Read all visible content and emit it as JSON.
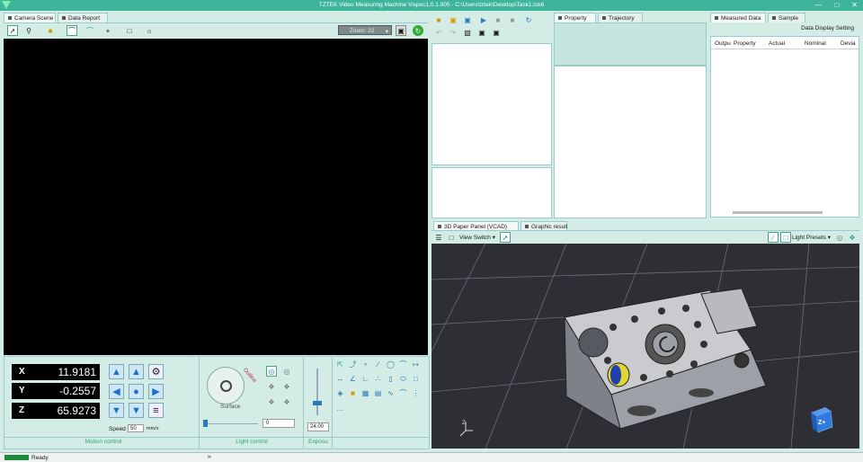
{
  "window": {
    "title": "TZTEK Video Measuring Machine Vispec1.0.1.005 - C:\\Users\\tztek\\Desktop\\Task1.tsk6"
  },
  "camera_panel": {
    "tabs": [
      "Camera Scene",
      "Data Report"
    ],
    "zoom_label": "Zoom: 22"
  },
  "dro": {
    "x_label": "X",
    "x_value": "11.9181",
    "y_label": "Y",
    "y_value": "-0.2557",
    "z_label": "Z",
    "z_value": "65.9273",
    "speed_label": "Speed",
    "speed_value": "50",
    "speed_unit": "mm/s"
  },
  "sections": {
    "motion": "Motion control",
    "light": "Light control",
    "exposure": "Exposu"
  },
  "light": {
    "outline_label": "Outline",
    "surface_label": "Surface",
    "slider_value": "0",
    "exposure_value": "24.00"
  },
  "property_panel": {
    "tabs": [
      "Property",
      "Trajectory"
    ]
  },
  "measured_panel": {
    "tabs": [
      "Measured Data",
      "Sample"
    ],
    "display_setting": "Data Display Setting",
    "columns": [
      "Outpu",
      "Property",
      "Actual",
      "Nominal",
      "Devia"
    ]
  },
  "cad_panel": {
    "tabs": [
      "3D Paper Panel (VCAD)",
      "Graphic result"
    ],
    "view_switch": "View Switch",
    "light_presets": "Light Presets",
    "cube_label": "Z+",
    "triad_label": "Z"
  },
  "status": {
    "text": "Ready"
  }
}
